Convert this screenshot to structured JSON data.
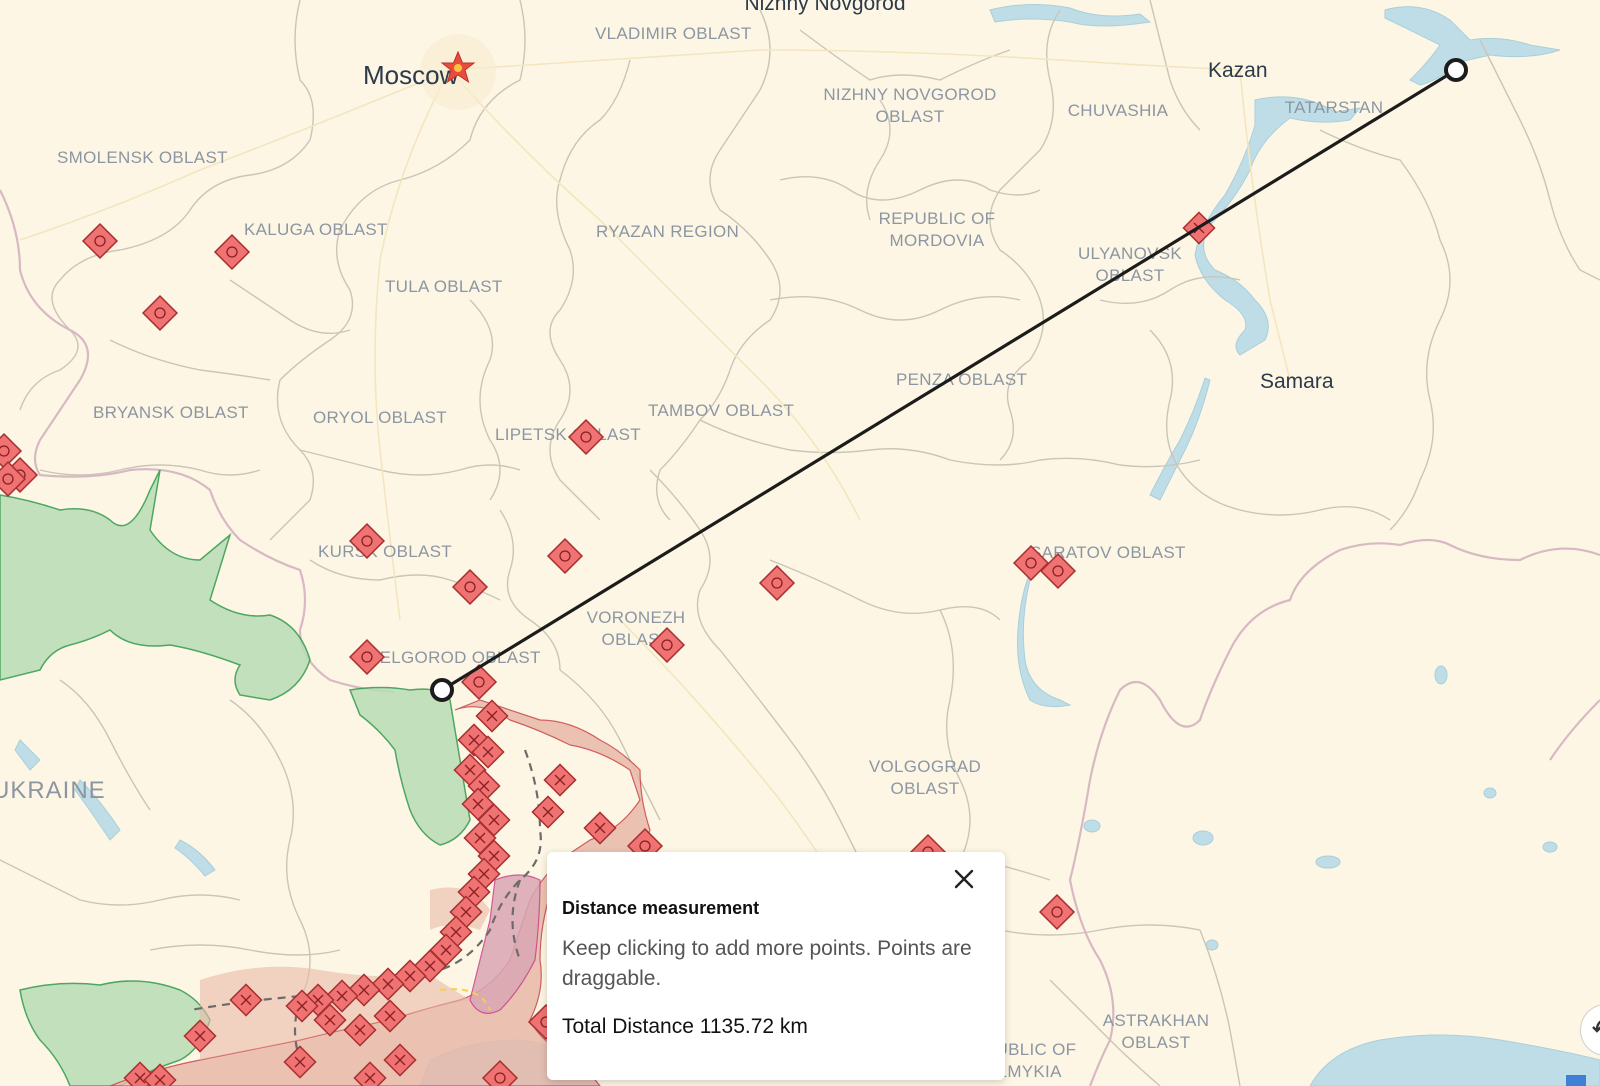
{
  "map": {
    "capital": "Moscow",
    "cities": [
      "Nizhny Novgorod",
      "Kazan",
      "Samara"
    ],
    "regions": [
      "VLADIMIR OBLAST",
      "NIZHNY NOVGOROD",
      "OBLAST",
      "CHUVASHIA",
      "TATARSTAN",
      "SMOLENSK OBLAST",
      "KALUGA OBLAST",
      "RYAZAN REGION",
      "REPUBLIC OF",
      "MORDOVIA",
      "ULYANOVSK",
      "OBLAST",
      "TULA OBLAST",
      "PENZA OBLAST",
      "BRYANSK OBLAST",
      "ORYOL OBLAST",
      "LIPETSK OBLAST",
      "TAMBOV OBLAST",
      "KURSK OBLAST",
      "SARATOV OBLAST",
      "VORONEZH",
      "OBLAST",
      "BELGOROD OBLAST",
      "VOLGOGRAD",
      "OBLAST",
      "ASTRAKHAN",
      "OBLAST",
      "REPUBLIC OF",
      "KALMYKIA"
    ],
    "country": "UKRAINE",
    "colors": {
      "land": "#fdf6e4",
      "water": "#bfdde6",
      "border": "#c9c3b6",
      "country_border": "#d9b9c4",
      "occupied": "#e9b9a9",
      "liberated": "#b9ddb6",
      "marker": "#f07373",
      "measure_line": "#1c1c1c"
    }
  },
  "measurement": {
    "title": "Distance measurement",
    "message": "Keep clicking to add more points. Points are draggable.",
    "total_label": "Total Distance",
    "total_value": "1135.72 km",
    "close_icon": "close-icon"
  }
}
